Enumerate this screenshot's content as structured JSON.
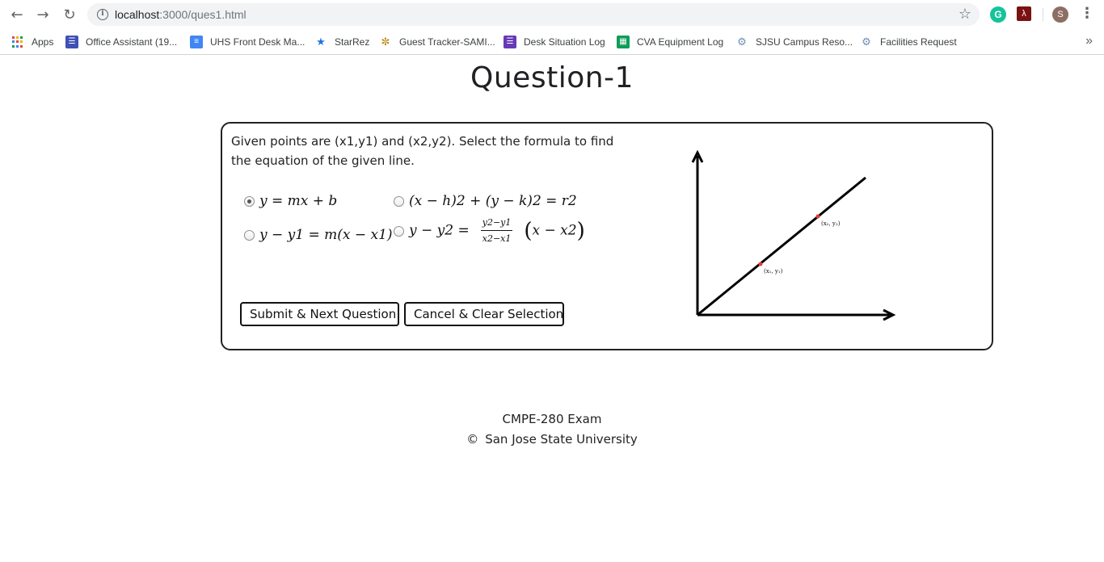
{
  "browser": {
    "url_host": "localhost",
    "url_path": ":3000/ques1.html",
    "avatar_letter": "S",
    "grammarly_letter": "G"
  },
  "bookmarks": [
    {
      "label": "Apps",
      "icon": "apps-grid-icon"
    },
    {
      "label": "Office Assistant (19...",
      "icon": "forms-icon"
    },
    {
      "label": "UHS Front Desk Ma...",
      "icon": "docs-icon"
    },
    {
      "label": "StarRez",
      "icon": "star-icon"
    },
    {
      "label": "Guest Tracker-SAMI...",
      "icon": "tracker-icon"
    },
    {
      "label": "Desk Situation Log",
      "icon": "forms-icon"
    },
    {
      "label": "CVA Equipment Log",
      "icon": "sheets-icon"
    },
    {
      "label": "SJSU Campus Reso...",
      "icon": "sjsu-icon"
    },
    {
      "label": "Facilities Request",
      "icon": "sjsu-icon"
    }
  ],
  "page": {
    "title": "Question-1",
    "question": "Given points are (x1,y1) and (x2,y2). Select the formula to find the equation of the given line.",
    "options": [
      {
        "id": "opt1",
        "text": "y = mx + b",
        "checked": true
      },
      {
        "id": "opt2",
        "text": "(x − h)2 + (y − k)2 = r2",
        "checked": false
      },
      {
        "id": "opt3",
        "text": "y − y1 = m(x − x1)",
        "checked": false
      },
      {
        "id": "opt4",
        "lhs": "y − y2 =",
        "num": "y2−y1",
        "den": "x2−x1",
        "rhs": "x − x2",
        "checked": false
      }
    ],
    "submit_label": "Submit & Next Question",
    "cancel_label": "Cancel & Clear Selection",
    "graph": {
      "point1_label": "(x₁, y₁)",
      "point2_label": "(x₂, y₂)",
      "point_color": "#e53935"
    }
  },
  "footer": {
    "line1": "CMPE-280 Exam",
    "copyright_symbol": "©",
    "line2": "San Jose State University"
  }
}
